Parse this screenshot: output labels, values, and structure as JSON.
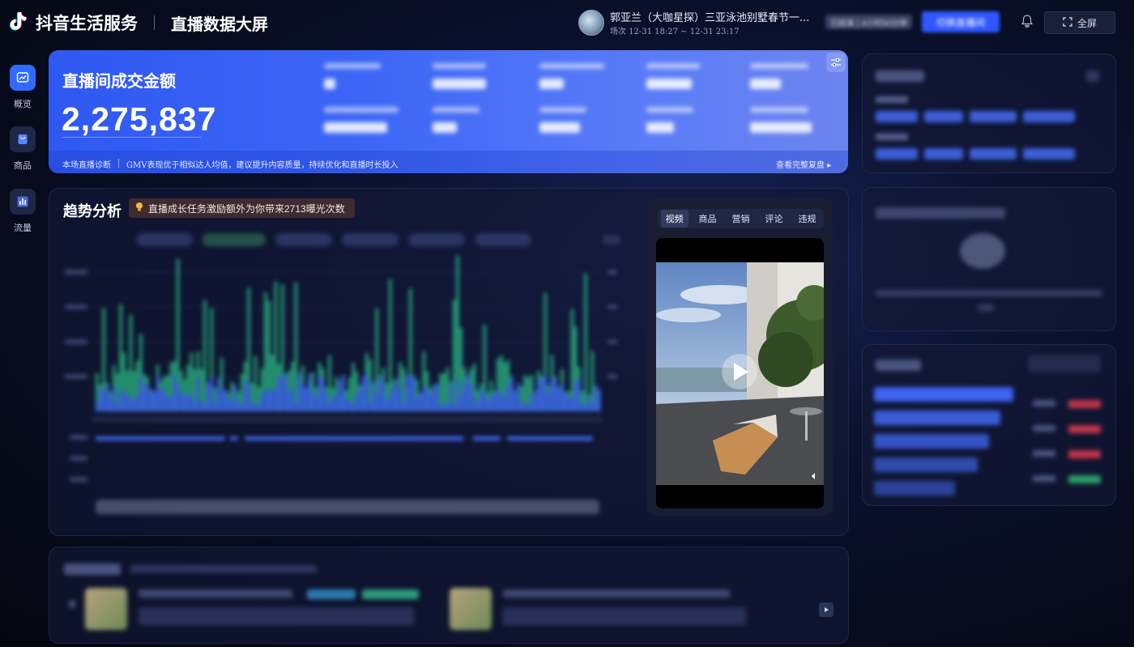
{
  "header": {
    "brand": "抖音生活服务",
    "page_title": "直播数据大屏",
    "live_title": "郭亚兰（大咖星探）三亚泳池别墅春节一...",
    "live_time": "场次 12-31 18:27 ~ 12-31 23:17",
    "status": "已结束 | 4小时50分钟",
    "switch_label": "切换直播间",
    "fullscreen_label": "全屏"
  },
  "nav": {
    "overview": "概览",
    "products": "商品",
    "traffic": "流量"
  },
  "hero": {
    "label": "直播间成交金额",
    "value": "2,275,837",
    "diag_label": "本场直播诊断",
    "diag_text": "GMV表现优于相似达人均值，建议提升内容质量，持续优化和直播时长投入",
    "replay_link": "查看完整复盘"
  },
  "trend": {
    "title": "趋势分析",
    "tip": "直播成长任务激励额外为你带来2713曝光次数"
  },
  "video": {
    "tabs": [
      "视频",
      "商品",
      "营销",
      "评论",
      "违规"
    ],
    "active_tab": "视频"
  },
  "colors": {
    "accent": "#3057ff",
    "series_green": "#2ec98c",
    "series_blue": "#3e5cf0"
  }
}
